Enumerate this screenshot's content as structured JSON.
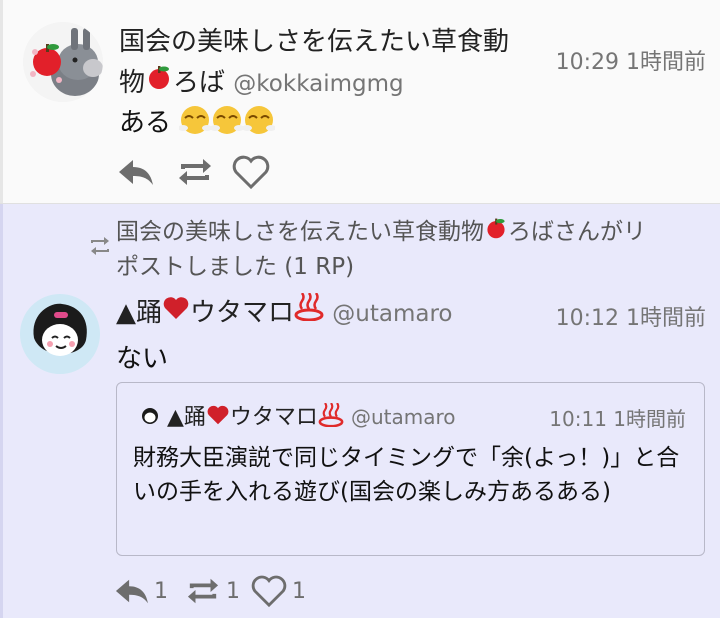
{
  "post1": {
    "display_name_line1": "国会の美味しさを伝えたい草食動",
    "display_name_line2": "物",
    "display_name_line2b": "ろば",
    "handle": "@kokkaimgmg",
    "time": "10:29 1時間前",
    "text": "ある",
    "emoji_icons": [
      "apple-icon",
      "steam-face-icon"
    ]
  },
  "repost": {
    "line1": "国会の美味しさを伝えたい草食動物",
    "line1b": "ろばさんがリ",
    "line2": "ポストしました (1 RP)"
  },
  "post2": {
    "name_prefix": "▲踊",
    "name_suffix": "ウタマロ",
    "handle": "@utamaro",
    "time": "10:12 1時間前",
    "text": "ない",
    "reply_count": "1",
    "renote_count": "1",
    "like_count": "1"
  },
  "quote": {
    "name_prefix": "▲踊",
    "name_suffix": "ウタマロ",
    "handle": "@utamaro",
    "time": "10:11 1時間前",
    "text": "財務大臣演説で同じタイミングで「余(よっ！)」と合いの手を入れる遊び(国会の楽しみ方あるある)"
  },
  "colors": {
    "post1_bg": "#fafafa",
    "post2_bg": "#e9e9fb",
    "icon_gray": "#6d6d6d",
    "heart_red": "#d0202a",
    "onsen_red": "#e02a2a"
  }
}
